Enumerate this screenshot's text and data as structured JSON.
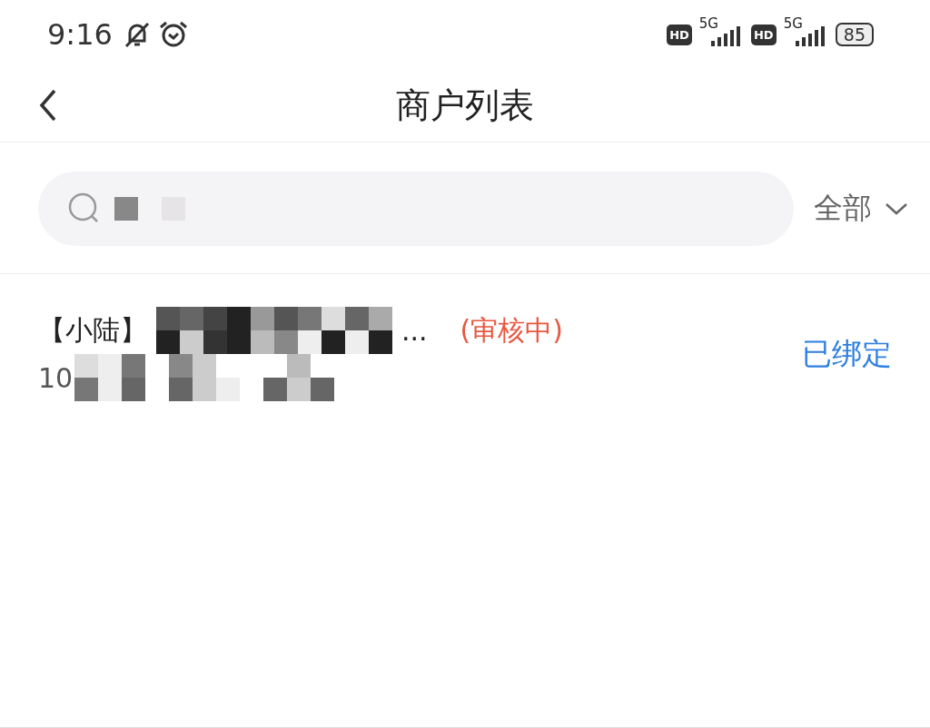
{
  "status_bar": {
    "time": "9:16",
    "sims": [
      {
        "badge": "HD",
        "network": "5G"
      },
      {
        "badge": "HD",
        "network": "5G"
      }
    ],
    "battery": "85"
  },
  "nav_bar": {
    "title": "商户列表"
  },
  "search": {
    "filter": "全部"
  },
  "merchants": [
    {
      "tag": "【小陆】",
      "name_end": "...",
      "status": "(审核中)",
      "id_start": "10",
      "binding": "已绑定"
    }
  ]
}
